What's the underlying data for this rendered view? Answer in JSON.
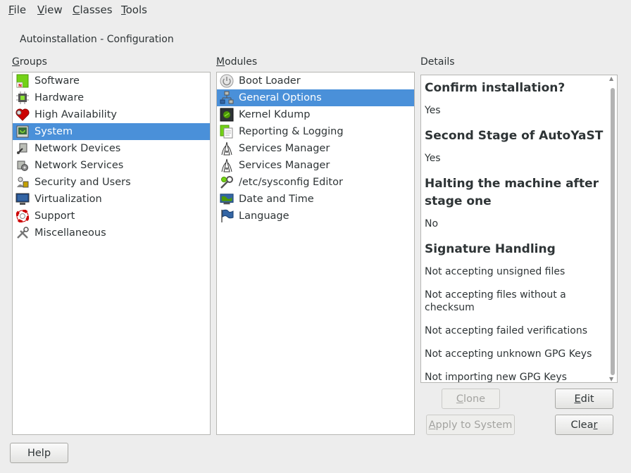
{
  "menu": [
    {
      "first": "F",
      "rest": "ile"
    },
    {
      "first": "V",
      "rest": "iew"
    },
    {
      "first": "C",
      "rest": "lasses"
    },
    {
      "first": "T",
      "rest": "ools"
    }
  ],
  "window_title": "Autoinstallation - Configuration",
  "groups": {
    "label_first": "G",
    "label_rest": "roups",
    "items": [
      {
        "label": "Software",
        "icon": "software-icon"
      },
      {
        "label": "Hardware",
        "icon": "hardware-icon"
      },
      {
        "label": "High Availability",
        "icon": "high-availability-icon"
      },
      {
        "label": "System",
        "icon": "system-icon",
        "selected": true
      },
      {
        "label": "Network Devices",
        "icon": "network-devices-icon"
      },
      {
        "label": "Network Services",
        "icon": "network-services-icon"
      },
      {
        "label": "Security and Users",
        "icon": "security-icon"
      },
      {
        "label": "Virtualization",
        "icon": "virtualization-icon"
      },
      {
        "label": "Support",
        "icon": "support-icon"
      },
      {
        "label": "Miscellaneous",
        "icon": "miscellaneous-icon"
      }
    ]
  },
  "modules": {
    "label_first": "M",
    "label_rest": "odules",
    "items": [
      {
        "label": "Boot Loader",
        "icon": "boot-loader-icon"
      },
      {
        "label": "General Options",
        "icon": "general-options-icon",
        "selected": true
      },
      {
        "label": "Kernel Kdump",
        "icon": "kernel-kdump-icon"
      },
      {
        "label": "Reporting & Logging",
        "icon": "reporting-icon"
      },
      {
        "label": "Services Manager",
        "icon": "services-manager-icon"
      },
      {
        "label": "Services Manager",
        "icon": "services-manager-icon"
      },
      {
        "label": "/etc/sysconfig Editor",
        "icon": "sysconfig-editor-icon"
      },
      {
        "label": "Date and Time",
        "icon": "date-time-icon"
      },
      {
        "label": "Language",
        "icon": "language-icon"
      }
    ]
  },
  "details": {
    "label": "Details",
    "sections": [
      {
        "heading": "Confirm installation?",
        "lines": [
          "Yes"
        ]
      },
      {
        "heading": "Second Stage of AutoYaST",
        "lines": [
          "Yes"
        ]
      },
      {
        "heading": "Halting the machine after stage one",
        "lines": [
          "No"
        ]
      },
      {
        "heading": "Signature Handling",
        "lines": [
          "Not accepting unsigned files",
          "Not accepting files without a checksum",
          "Not accepting failed verifications",
          "Not accepting unknown GPG Keys",
          "Not importing new GPG Keys"
        ]
      }
    ]
  },
  "buttons": {
    "clone": {
      "first": "C",
      "rest": "lone"
    },
    "edit": {
      "first": "E",
      "rest": "dit"
    },
    "apply": {
      "first": "A",
      "rest": "pply to System"
    },
    "clear": {
      "first": "Clea",
      "mid": "r",
      "rest": ""
    },
    "help": "Help"
  },
  "colors": {
    "selection": "#4a90d9",
    "background": "#ededed"
  }
}
